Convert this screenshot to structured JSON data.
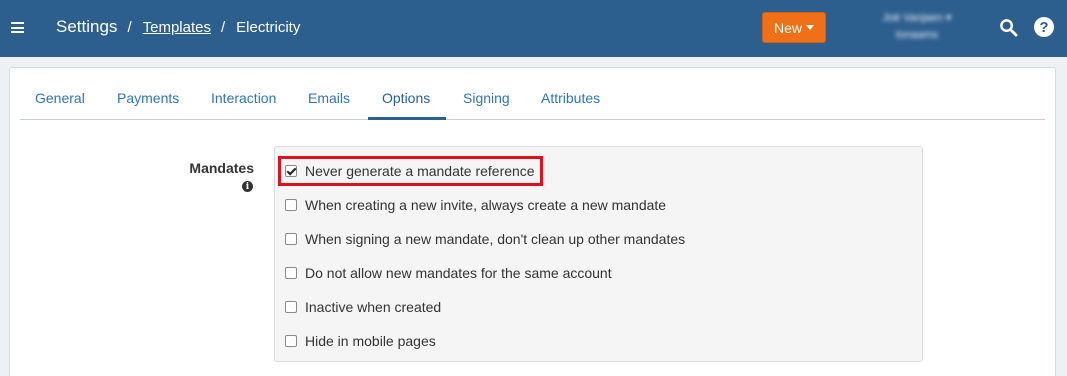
{
  "header": {
    "breadcrumb": [
      {
        "label": "Settings"
      },
      {
        "label": "Templates"
      },
      {
        "label": "Electricity"
      }
    ],
    "separator": "/",
    "new_button_label": "New",
    "user_line1": "Joë Vanjaen ▾",
    "user_line2": "tonaams",
    "icons": [
      "hamburger-menu-icon",
      "search-icon",
      "help-icon"
    ]
  },
  "tabs": [
    {
      "label": "General"
    },
    {
      "label": "Payments"
    },
    {
      "label": "Interaction"
    },
    {
      "label": "Emails"
    },
    {
      "label": "Options",
      "active": true
    },
    {
      "label": "Signing"
    },
    {
      "label": "Attributes"
    }
  ],
  "mandates": {
    "label": "Mandates",
    "info_glyph": "i",
    "options": [
      {
        "label": "Never generate a mandate reference",
        "checked": true
      },
      {
        "label": "When creating a new invite, always create a new mandate",
        "checked": false
      },
      {
        "label": "When signing a new mandate, don't clean up other mandates",
        "checked": false
      },
      {
        "label": "Do not allow new mandates for the same account",
        "checked": false
      },
      {
        "label": "Inactive when created",
        "checked": false
      },
      {
        "label": "Hide in mobile pages",
        "checked": false
      }
    ]
  },
  "colors": {
    "header_bg": "#2d5f8e",
    "new_button": "#ef7016",
    "tab_link": "#2f75b5",
    "highlight": "#e0101c"
  }
}
